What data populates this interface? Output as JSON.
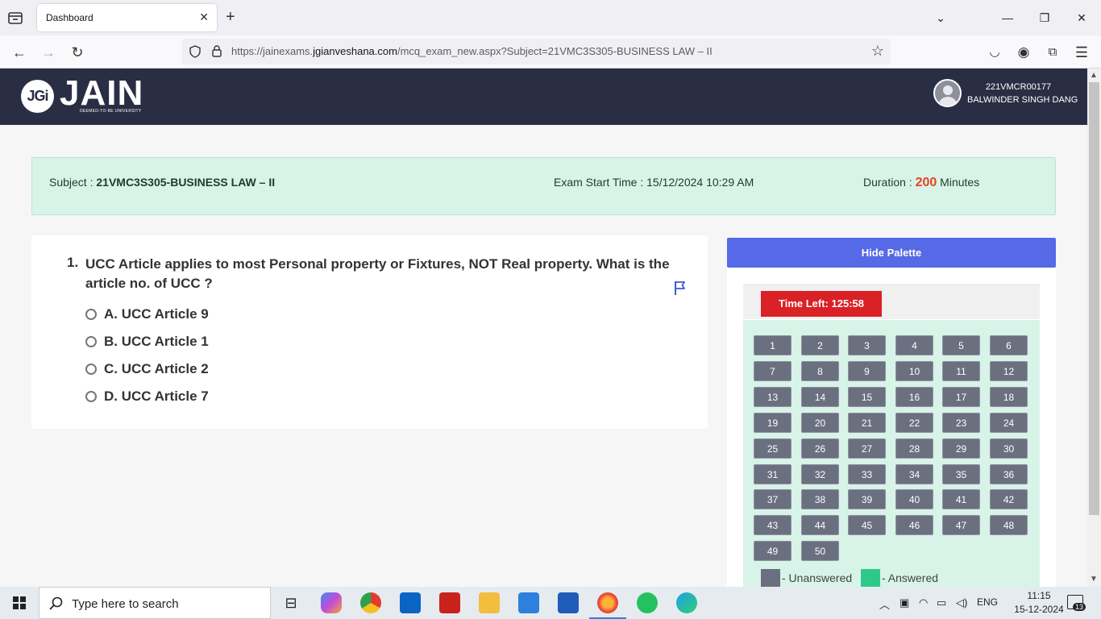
{
  "browser": {
    "tab_title": "Dashboard",
    "url_prefix": "https://jainexams.",
    "url_domain": "jgianveshana.com",
    "url_path": "/mcq_exam_new.aspx?Subject=21VMC3S305-BUSINESS LAW – II"
  },
  "header": {
    "logo_badge": "JGi",
    "logo_word": "JAIN",
    "logo_sub": "DEEMED-TO-BE UNIVERSITY",
    "user_id": "221VMCR00177",
    "user_name": "BALWINDER SINGH DANG"
  },
  "info": {
    "subject_label": "Subject : ",
    "subject_value": "21VMC3S305-BUSINESS LAW – II",
    "exam_start": "Exam Start Time : 15/12/2024 10:29 AM",
    "duration_label": "Duration : ",
    "duration_value": "200",
    "duration_unit": " Minutes"
  },
  "question": {
    "number": "1.",
    "text": "UCC Article applies to most Personal property or Fixtures, NOT Real property. What is the article no. of UCC ?",
    "options": [
      "A. UCC Article 9",
      "B. UCC Article 1",
      "C. UCC Article 2",
      "D. UCC Article 7"
    ]
  },
  "palette": {
    "hide_label": "Hide Palette",
    "time_left": "Time Left: 125:58",
    "questions": [
      "1",
      "2",
      "3",
      "4",
      "5",
      "6",
      "7",
      "8",
      "9",
      "10",
      "11",
      "12",
      "13",
      "14",
      "15",
      "16",
      "17",
      "18",
      "19",
      "20",
      "21",
      "22",
      "23",
      "24",
      "25",
      "26",
      "27",
      "28",
      "29",
      "30",
      "31",
      "32",
      "33",
      "34",
      "35",
      "36",
      "37",
      "38",
      "39",
      "40",
      "41",
      "42",
      "43",
      "44",
      "45",
      "46",
      "47",
      "48",
      "49",
      "50"
    ],
    "legend_unanswered": "- Unanswered",
    "legend_answered": "- Answered",
    "unanswered_color": "#6b7080",
    "answered_color": "#2ec98a"
  },
  "taskbar": {
    "search_placeholder": "Type here to search",
    "language": "ENG",
    "time": "11:15",
    "date": "15-12-2024",
    "notification_count": "13"
  }
}
